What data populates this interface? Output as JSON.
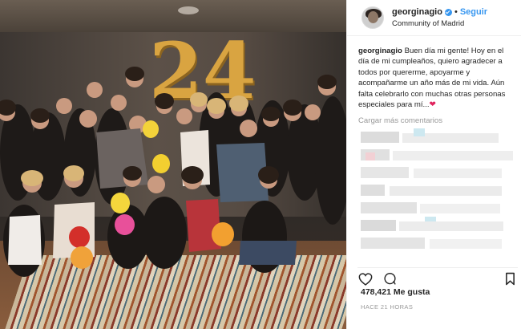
{
  "post": {
    "username": "georginagio",
    "follow_label": "Seguir",
    "location": "Community of Madrid",
    "caption_user": "georginagio",
    "caption_text": " Buen día mi gente! Hoy en el día de mi cumpleaños, quiero agradecer a todos por quererme, apoyarme y acompañarme un año más de mi vida. Aún falta celebrarlo con muchas otras personas especiales para mí...",
    "caption_emoji": "❤",
    "load_more": "Cargar más comentarios",
    "likes": "478,421 Me gusta",
    "time_ago": "HACE 21 HORAS",
    "photo_balloon_number": "24"
  },
  "icons": {
    "verified": "verified-badge-icon",
    "like": "heart-icon",
    "comment": "comment-icon",
    "save": "bookmark-icon"
  },
  "colors": {
    "link_blue": "#3897f0",
    "text": "#262626",
    "muted": "#999999",
    "balloon_gold": "#d9a441"
  }
}
